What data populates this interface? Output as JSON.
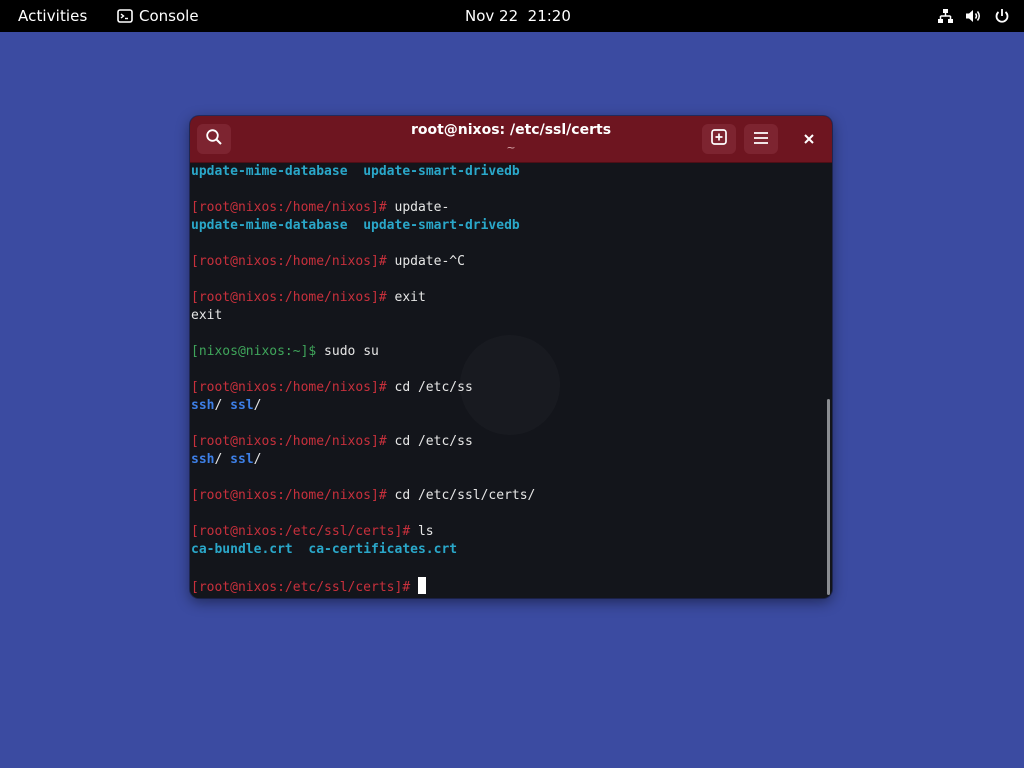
{
  "topbar": {
    "activities_label": "Activities",
    "app_name": "Console",
    "app_icon": "terminal-icon",
    "clock": "Nov 22  21:20",
    "tray_icons": [
      "network-icon",
      "volume-icon",
      "power-icon"
    ]
  },
  "window": {
    "title": "root@nixos: /etc/ssl/certs",
    "subtitle": "~",
    "buttons": [
      "search-icon",
      "new-tab-icon",
      "hamburger-menu-icon",
      "close-icon"
    ]
  },
  "colors": {
    "desktop_bg": "#3b4ba1",
    "headerbar_bg": "#6e1520",
    "terminal_bg": "#13151b",
    "prompt_red": "#c8303c",
    "prompt_green": "#3fa55b",
    "exec_cyan": "#2aa7c9",
    "dir_blue": "#3d7fe6"
  },
  "terminal": {
    "lines": [
      {
        "segments": [
          {
            "text": "update-mime-database",
            "color": "cyan"
          },
          {
            "text": "  "
          },
          {
            "text": "update-smart-drivedb",
            "color": "cyan"
          }
        ]
      },
      {
        "segments": []
      },
      {
        "segments": [
          {
            "text": "[root@nixos:/home/nixos]#",
            "color": "red"
          },
          {
            "text": " update-"
          }
        ]
      },
      {
        "segments": [
          {
            "text": "update-mime-database",
            "color": "cyan"
          },
          {
            "text": "  "
          },
          {
            "text": "update-smart-drivedb",
            "color": "cyan"
          }
        ]
      },
      {
        "segments": []
      },
      {
        "segments": [
          {
            "text": "[root@nixos:/home/nixos]#",
            "color": "red"
          },
          {
            "text": " update-^C"
          }
        ]
      },
      {
        "segments": []
      },
      {
        "segments": [
          {
            "text": "[root@nixos:/home/nixos]#",
            "color": "red"
          },
          {
            "text": " exit"
          }
        ]
      },
      {
        "segments": [
          {
            "text": "exit"
          }
        ]
      },
      {
        "segments": []
      },
      {
        "segments": [
          {
            "text": "[nixos@nixos:~]$",
            "color": "green"
          },
          {
            "text": " sudo su"
          }
        ]
      },
      {
        "segments": []
      },
      {
        "segments": [
          {
            "text": "[root@nixos:/home/nixos]#",
            "color": "red"
          },
          {
            "text": " cd /etc/ss"
          }
        ]
      },
      {
        "segments": [
          {
            "text": "ssh",
            "color": "blue"
          },
          {
            "text": "/ "
          },
          {
            "text": "ssl",
            "color": "blue"
          },
          {
            "text": "/"
          }
        ]
      },
      {
        "segments": []
      },
      {
        "segments": [
          {
            "text": "[root@nixos:/home/nixos]#",
            "color": "red"
          },
          {
            "text": " cd /etc/ss"
          }
        ]
      },
      {
        "segments": [
          {
            "text": "ssh",
            "color": "blue"
          },
          {
            "text": "/ "
          },
          {
            "text": "ssl",
            "color": "blue"
          },
          {
            "text": "/"
          }
        ]
      },
      {
        "segments": []
      },
      {
        "segments": [
          {
            "text": "[root@nixos:/home/nixos]#",
            "color": "red"
          },
          {
            "text": " cd /etc/ssl/certs/"
          }
        ]
      },
      {
        "segments": []
      },
      {
        "segments": [
          {
            "text": "[root@nixos:/etc/ssl/certs]#",
            "color": "red"
          },
          {
            "text": " ls"
          }
        ]
      },
      {
        "segments": [
          {
            "text": "ca-bundle.crt",
            "color": "cyan"
          },
          {
            "text": "  "
          },
          {
            "text": "ca-certificates.crt",
            "color": "cyan"
          }
        ]
      },
      {
        "segments": []
      },
      {
        "segments": [
          {
            "text": "[root@nixos:/etc/ssl/certs]#",
            "color": "red"
          },
          {
            "text": " "
          }
        ],
        "cursor": true
      }
    ]
  }
}
